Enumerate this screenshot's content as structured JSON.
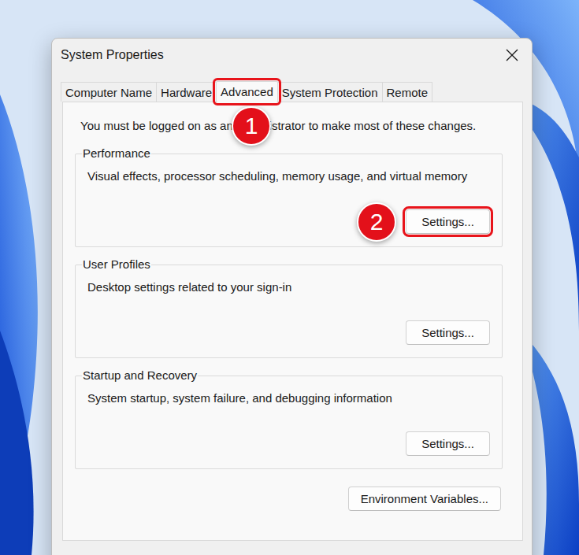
{
  "window": {
    "title": "System Properties"
  },
  "tabs": [
    {
      "label": "Computer Name",
      "selected": false,
      "callout": null
    },
    {
      "label": "Hardware",
      "selected": false,
      "callout": null
    },
    {
      "label": "Advanced",
      "selected": true,
      "callout": "1"
    },
    {
      "label": "System Protection",
      "selected": false,
      "callout": null
    },
    {
      "label": "Remote",
      "selected": false,
      "callout": null
    }
  ],
  "notice": "You must be logged on as an Administrator to make most of these changes.",
  "groups": [
    {
      "title": "Performance",
      "description": "Visual effects, processor scheduling, memory usage, and virtual memory",
      "button": "Settings...",
      "callout": "2"
    },
    {
      "title": "User Profiles",
      "description": "Desktop settings related to your sign-in",
      "button": "Settings...",
      "callout": null
    },
    {
      "title": "Startup and Recovery",
      "description": "System startup, system failure, and debugging information",
      "button": "Settings...",
      "callout": null
    }
  ],
  "footer_buttons": [
    "Environment Variables..."
  ]
}
